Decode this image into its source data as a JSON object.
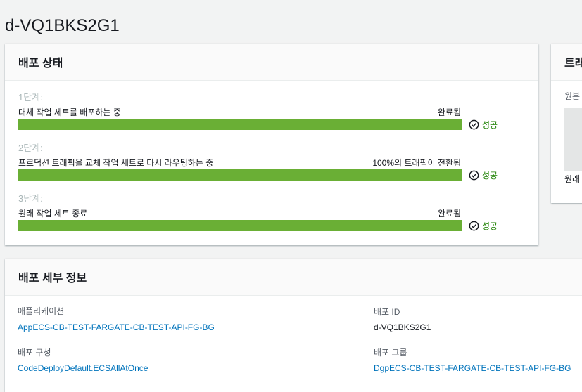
{
  "page": {
    "title": "d-VQ1BKS2G1"
  },
  "status_panel": {
    "title": "배포 상태",
    "steps": [
      {
        "label": "1단계:",
        "description": "대체 작업 세트를 배포하는 중",
        "status": "완료됨",
        "progress": 1.0,
        "result": "성공"
      },
      {
        "label": "2단계:",
        "description": "프로덕션 트래픽을 교체 작업 세트로 다시 라우팅하는 중",
        "status": "100%의 트래픽이 전환됨",
        "progress": 1.0,
        "result": "성공"
      },
      {
        "label": "3단계:",
        "description": "원래 작업 세트 종료",
        "status": "완료됨",
        "progress": 1.0,
        "result": "성공"
      }
    ]
  },
  "side_panel": {
    "title": "트래",
    "subtitle": "원본",
    "footer": "원래"
  },
  "details_panel": {
    "title": "배포 세부 정보",
    "application_label": "애플리케이션",
    "application_value": "AppECS-CB-TEST-FARGATE-CB-TEST-API-FG-BG",
    "deployment_id_label": "배포 ID",
    "deployment_id_value": "d-VQ1BKS2G1",
    "config_label": "배포 구성",
    "config_value": "CodeDeployDefault.ECSAllAtOnce",
    "group_label": "배포 그룹",
    "group_value": "DgpECS-CB-TEST-FARGATE-CB-TEST-API-FG-BG"
  },
  "colors": {
    "progress_fill": "#6aaf35",
    "success": "#1d8102",
    "link": "#0073bb"
  },
  "icons": {
    "result": "check-circle-icon"
  }
}
